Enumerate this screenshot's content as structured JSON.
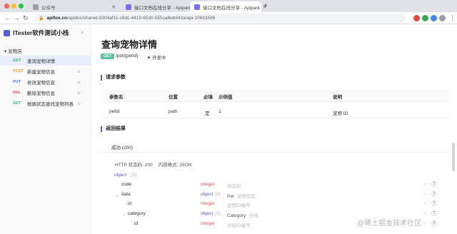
{
  "browser": {
    "tabs": [
      {
        "title": "公众号"
      },
      {
        "title": "接口文档在线分享 - Apipark"
      },
      {
        "title": "接口文档在线分享 - Apipark"
      }
    ],
    "url_host": "apifox.cn",
    "url_path": "/apidoc/shared-8304af11-c8dc-4419-9530-555ca8eb843a/api-10693596"
  },
  "sidebar": {
    "project_name": "ITester软件测试小栈",
    "folder": "宠物店",
    "items": [
      {
        "method": "GET",
        "method_color": "#3bb27a",
        "label": "查询宠物详情"
      },
      {
        "method": "POST",
        "method_color": "#e6a23c",
        "label": "新建宠物信息"
      },
      {
        "method": "PUT",
        "method_color": "#4a7cf0",
        "label": "修改宠物信息"
      },
      {
        "method": "DEL",
        "method_color": "#e45757",
        "label": "删除宠物信息"
      },
      {
        "method": "GET",
        "method_color": "#3bb27a",
        "label": "根据状态查找宠物列表"
      }
    ]
  },
  "main": {
    "title": "查询宠物详情",
    "method": "GET",
    "path": "/pet/{petId}",
    "status": "开发中",
    "request_section": "请求参数",
    "params_headers": [
      "参数名",
      "位置",
      "必填",
      "示例值",
      "说明"
    ],
    "params_rows": [
      {
        "name": "petId",
        "location": "path",
        "required": "是",
        "example": "1",
        "desc": "宠物 ID"
      }
    ],
    "response_section": "返回结果",
    "response_tab": "成功 (200)",
    "http_status": "HTTP 状态码: 200",
    "content_format": "内容格式: JSON",
    "tree": [
      {
        "key": "object",
        "extra": "[2]"
      },
      {
        "key": "code",
        "type": "integer",
        "desc": "状态码",
        "num": "2"
      },
      {
        "key": "data",
        "type": "object",
        "count": "[6]",
        "name": "Pet",
        "desc": "宠物信息",
        "num": "2"
      },
      {
        "key": "id",
        "type": "integer",
        "desc": "宠物ID编号",
        "num": "3"
      },
      {
        "key": "category",
        "type": "object",
        "count": "[2]",
        "name": "Category",
        "desc": "分组",
        "num": "2"
      },
      {
        "key": "id",
        "type": "integer",
        "desc": "分组ID编号",
        "num": "3"
      }
    ]
  },
  "watermark": "@稀土掘金技术社区"
}
